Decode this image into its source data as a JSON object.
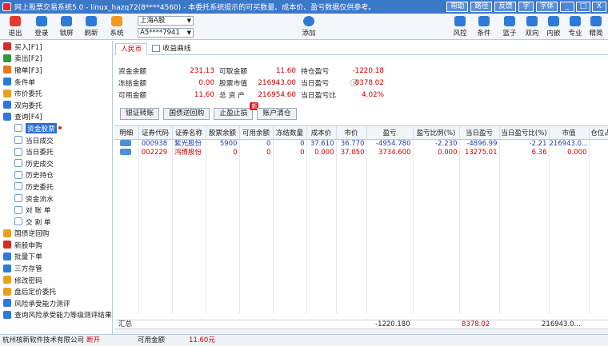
{
  "window": {
    "title": "网上股票交易系统5.0 - linux_hazq72(8****4560) - 本委托系统提示的可买数量、成本价、盈亏数据仅供参考。",
    "buttons": [
      "帮助",
      "路径",
      "反馈",
      "字",
      "字体"
    ],
    "min": "_",
    "max": "□",
    "close": "X"
  },
  "toolbar": {
    "left": [
      {
        "label": "退出",
        "icon": "power-icon",
        "color": "#e23b2e"
      },
      {
        "label": "登录",
        "icon": "user-icon",
        "color": "#2e7ad9"
      },
      {
        "label": "锁屏",
        "icon": "lock-icon",
        "color": "#2e7ad9"
      },
      {
        "label": "刷新",
        "icon": "refresh-icon",
        "color": "#2e7ad9"
      },
      {
        "label": "系统",
        "icon": "gear-icon",
        "color": "#f39a1e"
      }
    ],
    "market_select": "上海A股",
    "account_select": "A5****7941",
    "add_label": "添加",
    "right": [
      {
        "label": "风控",
        "icon": "shield-icon",
        "color": "#2e7ad9"
      },
      {
        "label": "条件",
        "icon": "condition-icon",
        "color": "#2e7ad9"
      },
      {
        "label": "篮子",
        "icon": "basket-icon",
        "color": "#2e7ad9"
      },
      {
        "label": "双向",
        "icon": "two-way-icon",
        "color": "#2e7ad9"
      },
      {
        "label": "内嵌",
        "icon": "embed-icon",
        "color": "#2e7ad9"
      },
      {
        "label": "专业",
        "icon": "pro-icon",
        "color": "#2e7ad9"
      },
      {
        "label": "精简",
        "icon": "compact-icon",
        "color": "#2e7ad9"
      }
    ]
  },
  "sidebar": {
    "items": [
      {
        "label": "买入[F1]",
        "icon": "buy-icon",
        "color": "#d92a2a",
        "sub": false
      },
      {
        "label": "卖出[F2]",
        "icon": "sell-icon",
        "color": "#2a9a3a",
        "sub": false
      },
      {
        "label": "撤单[F3]",
        "icon": "cancel-order-icon",
        "color": "#e87a1e",
        "sub": false
      },
      {
        "label": "条件单",
        "icon": "conditional-icon",
        "color": "#2e7ad9",
        "sub": false
      },
      {
        "label": "市价委托",
        "icon": "market-order-icon",
        "color": "#e8a11e",
        "sub": false
      },
      {
        "label": "双向委托",
        "icon": "two-way-order-icon",
        "color": "#2e7ad9",
        "sub": false
      },
      {
        "label": "查询[F4]",
        "icon": "query-icon",
        "color": "#2e7ad9",
        "sub": false
      },
      {
        "label": "资金股票",
        "icon": "doc-icon",
        "color": "#2e7ad9",
        "sub": true,
        "active": true
      },
      {
        "label": "当日成交",
        "icon": "doc-icon",
        "color": "#2e7ad9",
        "sub": true
      },
      {
        "label": "当日委托",
        "icon": "doc-icon",
        "color": "#2e7ad9",
        "sub": true
      },
      {
        "label": "历史成交",
        "icon": "doc-icon",
        "color": "#2e7ad9",
        "sub": true
      },
      {
        "label": "历史持仓",
        "icon": "doc-icon",
        "color": "#2e7ad9",
        "sub": true
      },
      {
        "label": "历史委托",
        "icon": "doc-icon",
        "color": "#2e7ad9",
        "sub": true
      },
      {
        "label": "资金流水",
        "icon": "doc-icon",
        "color": "#2e7ad9",
        "sub": true
      },
      {
        "label": "对 账 单",
        "icon": "doc-icon",
        "color": "#2e7ad9",
        "sub": true
      },
      {
        "label": "交 割 单",
        "icon": "doc-icon",
        "color": "#2e7ad9",
        "sub": true
      },
      {
        "label": "国债逆回购",
        "icon": "bond-icon",
        "color": "#e8a11e",
        "sub": false
      },
      {
        "label": "新股申购",
        "icon": "ipo-icon",
        "color": "#d92a2a",
        "sub": false
      },
      {
        "label": "批量下单",
        "icon": "batch-icon",
        "color": "#2e7ad9",
        "sub": false
      },
      {
        "label": "三方存管",
        "icon": "bank-icon",
        "color": "#2e7ad9",
        "sub": false
      },
      {
        "label": "修改密码",
        "icon": "key-icon",
        "color": "#e8a11e",
        "sub": false
      },
      {
        "label": "盘后定价委托",
        "icon": "after-hours-icon",
        "color": "#e8a11e",
        "sub": false
      },
      {
        "label": "风险承受能力测评",
        "icon": "risk-icon",
        "color": "#2e7ad9",
        "sub": false
      },
      {
        "label": "查询风险承受能力等级测评结果",
        "icon": "risk-result-icon",
        "color": "#2e7ad9",
        "sub": false
      }
    ]
  },
  "tabs": [
    "人民币",
    "收益曲线"
  ],
  "summary": [
    {
      "l1": "资金余额",
      "v1": "231.13",
      "l2": "可取金额",
      "v2": "11.60",
      "l3": "持仓盈亏",
      "v3": "-1220.18"
    },
    {
      "l1": "冻结金额",
      "v1": "0.00",
      "l2": "股票市值",
      "v2": "216943.00",
      "l3": "当日盈亏",
      "v3": "8378.02"
    },
    {
      "l1": "可用金额",
      "v1": "11.60",
      "l2": "总 资 产",
      "v2": "216954.60",
      "l3": "当日盈亏比",
      "v3": "4.02%"
    }
  ],
  "action_buttons": [
    "银证转账",
    "国债逆回购",
    "止盈止损",
    "账户清仓"
  ],
  "new_badge": "新",
  "table": {
    "columns": [
      "明细",
      "证券代码",
      "证券名称",
      "股票余额",
      "可用余额",
      "冻结数量",
      "成本价",
      "市价",
      "盈亏",
      "盈亏比例(%)",
      "当日盈亏",
      "当日盈亏比(%)",
      "市值",
      "仓位占"
    ],
    "rows": [
      [
        "",
        "000938",
        "紫光股份",
        "5900",
        "0",
        "0",
        "37.610",
        "36.770",
        "-4954.780",
        "-2.230",
        "-4896.99",
        "-2.21",
        "216943.0..."
      ],
      [
        "",
        "002229",
        "鸿博股份",
        "0",
        "0",
        "0",
        "0.000",
        "37.050",
        "3734.600",
        "0.000",
        "13275.01",
        "6.36",
        "0.000"
      ]
    ],
    "summary_label": "汇总",
    "summary_pnl": "-1220.180",
    "summary_day_pnl": "8378.02",
    "summary_value": "216943.0..."
  },
  "status": {
    "company": "杭州核新软件技术有限公司",
    "conn": "断开",
    "avail_label": "可用金额",
    "avail_value": "11.60元"
  }
}
